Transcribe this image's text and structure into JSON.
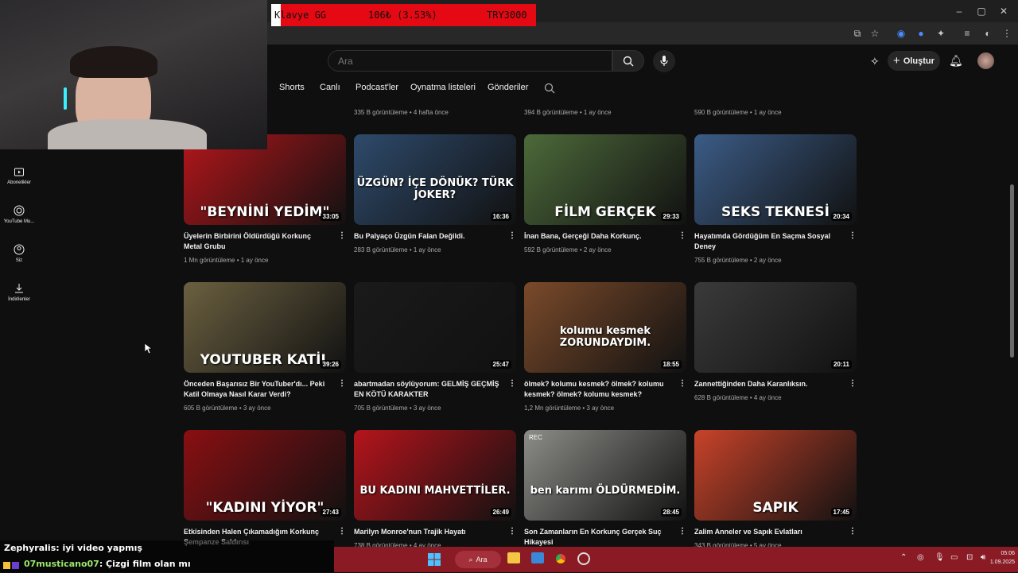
{
  "donation": {
    "label": "Klavye GG",
    "amount": "106₺ (3.53%)",
    "goal": "TRY3000",
    "progress_percent": 3.53
  },
  "search": {
    "placeholder": "Ara"
  },
  "header": {
    "create_label": "Oluştur"
  },
  "tabs": [
    "Shorts",
    "Canlı",
    "Podcast'ler",
    "Oynatma listeleri",
    "Gönderiler"
  ],
  "sidebar": [
    {
      "label": "Abonelikler",
      "icon": "subscriptions-icon"
    },
    {
      "label": "YouTube Mu...",
      "icon": "youtube-music-icon"
    },
    {
      "label": "Siz",
      "icon": "you-icon"
    },
    {
      "label": "İndirilenler",
      "icon": "downloads-icon"
    }
  ],
  "previous_row": [
    {
      "meta": "335 B görüntüleme • 4 hafta önce"
    },
    {
      "meta": "394 B görüntüleme • 1 ay önce"
    },
    {
      "meta": "590 B görüntüleme • 1 ay önce"
    }
  ],
  "videos": [
    {
      "thumb_text": "\"BEYNİNİ YEDİM\"",
      "duration": "33:05",
      "title": "Üyelerin Birbirini Öldürdüğü Korkunç Metal Grubu",
      "meta": "1 Mn görüntüleme • 1 ay önce",
      "accent": "#b3161b"
    },
    {
      "thumb_text": "ÜZGÜN? İÇE DÖNÜK? TÜRK JOKER?",
      "duration": "16:36",
      "title": "Bu Palyaço Üzgün Falan Değildi.",
      "meta": "283 B görüntüleme • 1 ay önce",
      "accent": "#2e4a6b"
    },
    {
      "thumb_text": "FİLM   GERÇEK",
      "duration": "29:33",
      "title": "İnan Bana, Gerçeği Daha Korkunç.",
      "meta": "592 B görüntüleme • 2 ay önce",
      "accent": "#4d6a3a"
    },
    {
      "thumb_text": "SEKS TEKNESİ",
      "duration": "20:34",
      "title": "Hayatımda Gördüğüm En Saçma Sosyal Deney",
      "meta": "755 B görüntüleme • 2 ay önce",
      "accent": "#3b5c86"
    },
    {
      "thumb_text": "YOUTUBER KATİL",
      "duration": "39:26",
      "title": "Önceden Başarısız Bir YouTuber'dı... Peki Katil Olmaya Nasıl Karar Verdi?",
      "meta": "605 B görüntüleme • 3 ay önce",
      "accent": "#6b6040"
    },
    {
      "thumb_text": "",
      "duration": "25:47",
      "title": "abartmadan söylüyorum: GELMİŞ GEÇMİŞ EN KÖTÜ KARAKTER",
      "meta": "705 B görüntüleme • 3 ay önce",
      "accent": "#1a1a1a"
    },
    {
      "thumb_text": "kolumu kesmek ZORUNDAYDIM.",
      "duration": "18:55",
      "title": "ölmek? kolumu kesmek? ölmek? kolumu kesmek? ölmek? kolumu kesmek?",
      "meta": "1,2 Mn görüntüleme • 3 ay önce",
      "accent": "#7a4a2a"
    },
    {
      "thumb_text": "",
      "duration": "20:11",
      "title": "Zannettiğinden Daha Karanlıksın.",
      "meta": "628 B görüntüleme • 4 ay önce",
      "accent": "#3a3a3a"
    },
    {
      "thumb_text": "\"KADINI YİYOR\"",
      "duration": "27:43",
      "title": "Etkisinden Halen Çıkamadığım Korkunç Şempanze Saldırısı",
      "meta": "",
      "accent": "#8a0f12"
    },
    {
      "thumb_text": "BU KADINI MAHVETTİLER.",
      "duration": "26:49",
      "title": "Marilyn Monroe'nun Trajik Hayatı",
      "meta": "738 B görüntüleme • 4 ay önce",
      "accent": "#b5141c"
    },
    {
      "thumb_text": "ben karımı ÖLDÜRMEDİM.",
      "duration": "28:45",
      "title": "Son Zamanların En Korkunç Gerçek Suç Hikayesi",
      "meta": "",
      "accent": "#8c8c88",
      "rec": "REC"
    },
    {
      "thumb_text": "SAPIK",
      "duration": "17:45",
      "title": "Zalim Anneler ve Sapık Evlatları",
      "meta": "343 B görüntüleme • 5 ay önce",
      "accent": "#c8432a"
    }
  ],
  "chat": [
    {
      "user": "Zephyralis",
      "message": ": iyi video yapmış"
    },
    {
      "user": "07musticano07",
      "message": ": Çizgi film olan mı"
    }
  ],
  "taskbar": {
    "search_label": "Ara",
    "time": "05:06",
    "date": "1.09.2025"
  },
  "colors": {
    "yt_bg": "#0f0f0f",
    "taskbar": "#8a1a24",
    "donation_bar": "#e50914"
  }
}
